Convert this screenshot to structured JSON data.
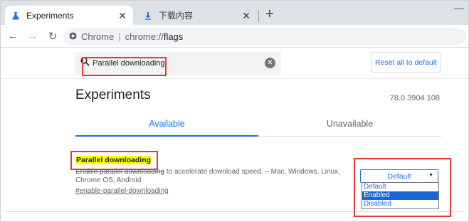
{
  "tabs": [
    {
      "label": "Experiments",
      "icon": "flask-icon",
      "active": true
    },
    {
      "label": "下载内容",
      "icon": "download-icon",
      "active": false
    }
  ],
  "window": {
    "minimize_glyph": "—"
  },
  "toolbar": {
    "site_label": "Chrome",
    "url_scheme": "chrome://",
    "url_host": "flags"
  },
  "search": {
    "value": "Parallel downloading"
  },
  "reset_label": "Reset all to default",
  "page": {
    "title": "Experiments",
    "version": "78.0.3904.108"
  },
  "content_tabs": {
    "available": "Available",
    "unavailable": "Unavailable"
  },
  "experiment": {
    "title": "Parallel downloading",
    "desc_struck": "Enable parallel downloading",
    "desc_rest": " to accelerate download speed. – Mac, Windows, Linux, Chrome OS, Android",
    "link": "#enable-parallel-downloading"
  },
  "select": {
    "value": "Default",
    "options": [
      "Default",
      "Enabled",
      "Disabled"
    ],
    "highlighted": "Enabled"
  },
  "colors": {
    "accent": "#1a73e8",
    "highlight": "#ffff00",
    "annotation": "#e53935"
  }
}
